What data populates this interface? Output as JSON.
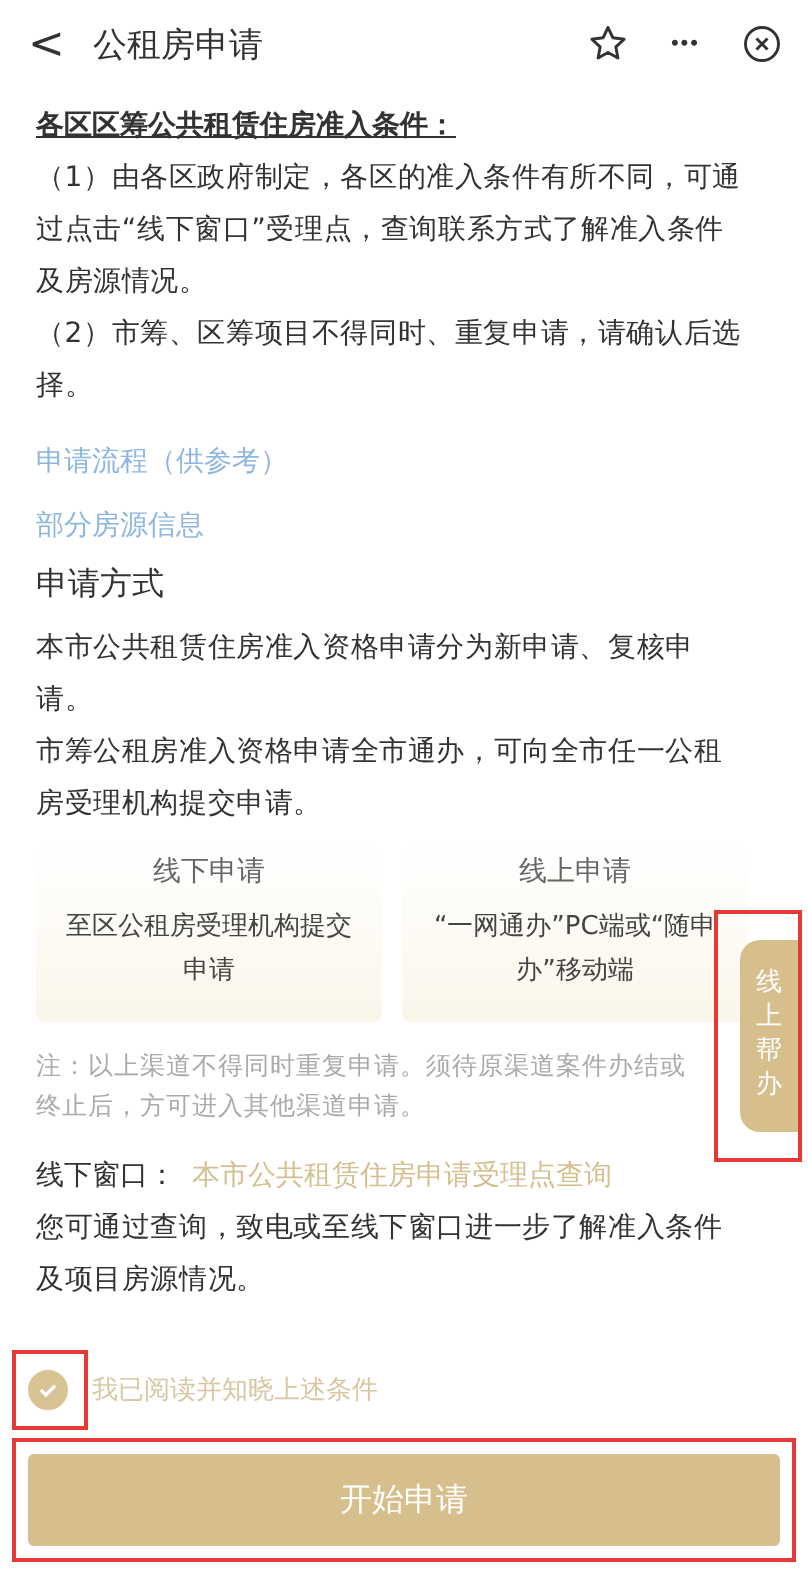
{
  "nav_bar": {
    "back": "<",
    "title": "公租房申请",
    "more": "•••"
  },
  "conditions": {
    "heading": "各区区筹公共租赁住房准入条件：",
    "paragraphs": [
      "（1）由各区政府制定，各区的准入条件有所不同，可通过点击“线下窗口”受理点，查询联系方式了解准入条件及房源情况。",
      "（2）市筹、区筹项目不得同时、重复申请，请确认后选择。"
    ]
  },
  "links": [
    "申请流程（供参考）",
    "部分房源信息"
  ],
  "method": {
    "heading": "申请方式",
    "paragraphs": [
      "本市公共租赁住房准入资格申请分为新申请、复核申请。",
      "市筹公租房准入资格申请全市通办，可向全市任一公租房受理机构提交申请。"
    ]
  },
  "channels": [
    {
      "title": "线下申请",
      "text": "至区公租房受理机构提交申请"
    },
    {
      "title": "线上申请",
      "text": "“一网通办”PC端或“随申办”移动端"
    }
  ],
  "note": "注：以上渠道不得同时重复申请。须待原渠道案件办结或终止后，方可进入其他渠道申请。",
  "offline_window": {
    "label": "线下窗口：",
    "link": "本市公共租赁住房申请受理点查询",
    "text": "您可通过查询，致电或至线下窗口进一步了解准入条件及项目房源情况。"
  },
  "float_button": {
    "label": "线上帮办",
    "highlighted": true
  },
  "agreement": {
    "label": "我已阅读并知晓上述条件",
    "checked": true,
    "highlighted": true
  },
  "start_button": {
    "label": "开始申请",
    "highlighted": true
  }
}
